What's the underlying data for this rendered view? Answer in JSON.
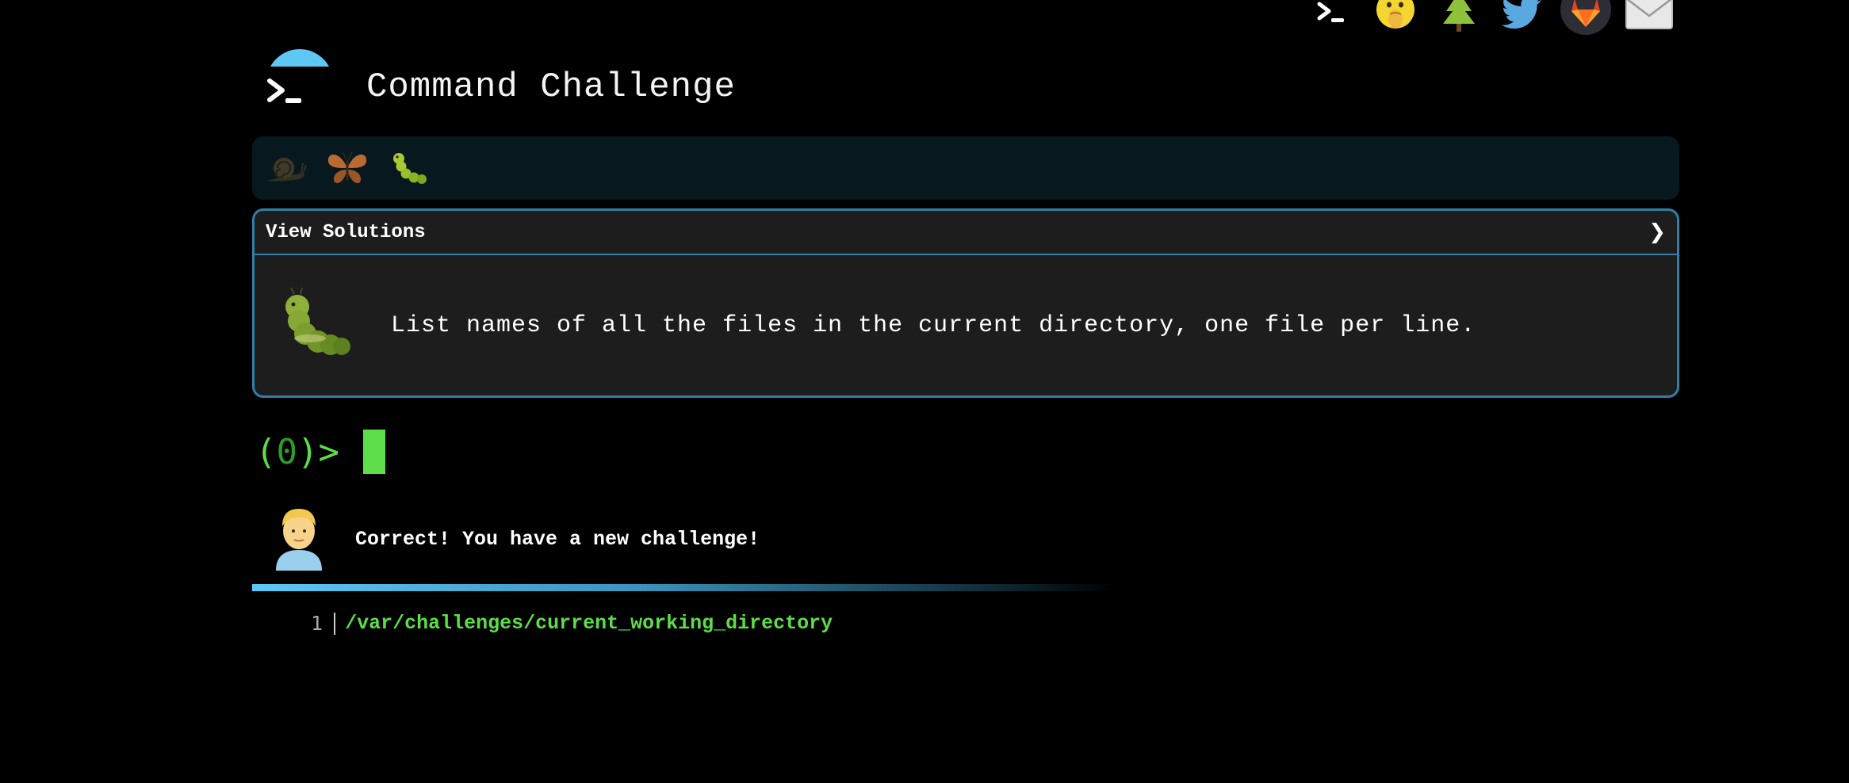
{
  "top_icons": [
    {
      "name": "terminal-icon",
      "glyph": ">_"
    },
    {
      "name": "face-with-hand-over-mouth-icon",
      "glyph": "🤭"
    },
    {
      "name": "evergreen-tree-icon",
      "glyph": "🌲"
    },
    {
      "name": "twitter-bird-icon",
      "glyph": ""
    },
    {
      "name": "gitlab-fox-icon",
      "glyph": ""
    },
    {
      "name": "envelope-icon",
      "glyph": "✉"
    }
  ],
  "header": {
    "title": "Command Challenge"
  },
  "levels": [
    {
      "name": "snail-icon",
      "glyph": "🐌"
    },
    {
      "name": "butterfly-icon",
      "glyph": "🦋"
    },
    {
      "name": "caterpillar-icon",
      "glyph": "🐛"
    }
  ],
  "card": {
    "solutions_label": "View Solutions",
    "chevron": "❯",
    "task": "List names of all the files in the current directory, one file per line."
  },
  "prompt": {
    "open": "(",
    "count": "0",
    "close": ")>"
  },
  "feedback": {
    "message": "Correct! You have a new challenge!"
  },
  "output": {
    "line_number": "1",
    "text": "/var/challenges/current_working_directory"
  },
  "colors": {
    "accent_blue": "#5ec8f5",
    "card_border": "#2f7fa9",
    "terminal_green": "#5dde48",
    "background": "#000000"
  }
}
